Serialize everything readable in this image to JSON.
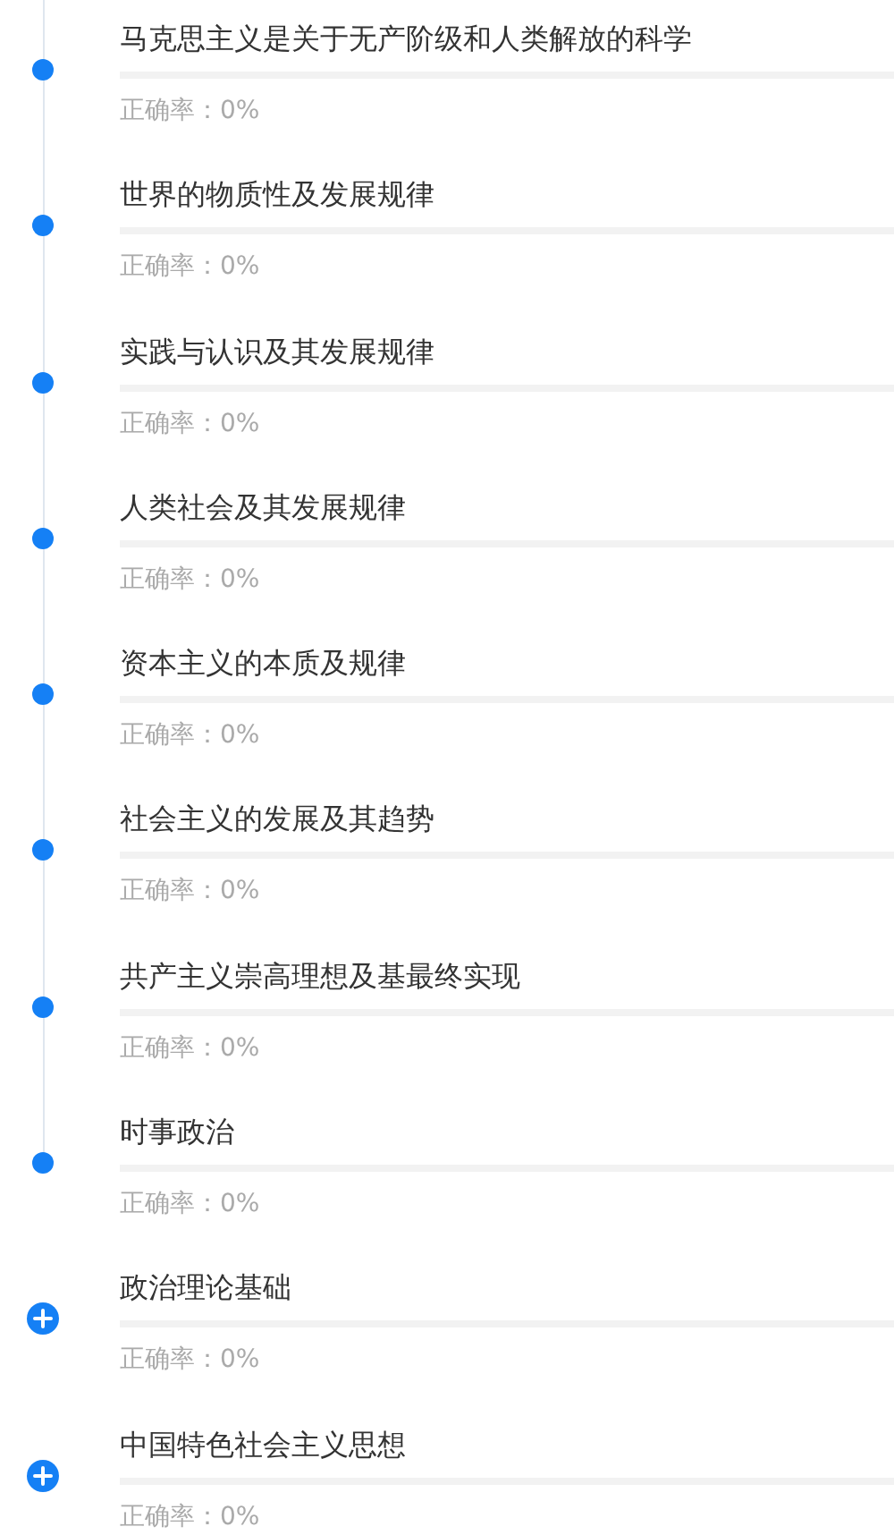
{
  "chapters": [
    {
      "kind": "dot",
      "title": "马克思主义是关于无产阶级和人类解放的科学",
      "level": 0,
      "accuracy": "正确率：0%"
    },
    {
      "kind": "dot",
      "title": "世界的物质性及发展规律",
      "level": 0,
      "accuracy": "正确率：0%"
    },
    {
      "kind": "dot",
      "title": "实践与认识及其发展规律",
      "level": 0,
      "accuracy": "正确率：0%"
    },
    {
      "kind": "dot",
      "title": "人类社会及其发展规律",
      "level": 0,
      "accuracy": "正确率：0%"
    },
    {
      "kind": "dot",
      "title": "资本主义的本质及规律",
      "level": 0,
      "accuracy": "正确率：0%"
    },
    {
      "kind": "dot",
      "title": "社会主义的发展及其趋势",
      "level": 0,
      "accuracy": "正确率：0%"
    },
    {
      "kind": "dot",
      "title": "共产主义崇高理想及基最终实现",
      "level": 0,
      "accuracy": "正确率：0%"
    },
    {
      "kind": "dot",
      "title": "时事政治",
      "level": 0,
      "accuracy": "正确率：0%"
    },
    {
      "kind": "expand",
      "title": "政治理论基础",
      "level": 0,
      "accuracy": "正确率：0%"
    },
    {
      "kind": "expand",
      "title": "中国特色社会主义思想",
      "level": 0,
      "accuracy": "正确率：0%"
    }
  ]
}
